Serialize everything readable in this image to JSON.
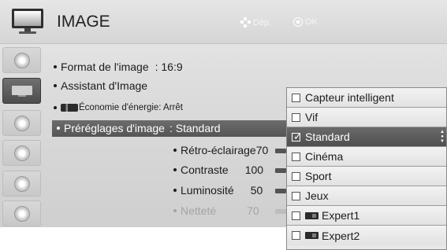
{
  "header": {
    "title": "IMAGE",
    "hint_move": "Dép.",
    "hint_ok": "OK"
  },
  "sidebar": {
    "items": [
      {
        "icon": "picture-tv-icon",
        "active": false
      },
      {
        "icon": "tv-screen-icon",
        "active": true
      },
      {
        "icon": "speaker-icon",
        "active": false
      },
      {
        "icon": "clock-icon",
        "active": false
      },
      {
        "icon": "lock-icon",
        "active": false
      },
      {
        "icon": "option-icon",
        "active": false
      }
    ]
  },
  "menu": {
    "format_label": "Format de l'image",
    "format_value": ": 16:9",
    "assistant_label": "Assistant d'Image",
    "eco_label": "Économie d'énergie: Arrêt",
    "preset_label": "Préréglages d'image",
    "preset_value": ": Standard"
  },
  "settings": [
    {
      "label": "Rétro-éclairage",
      "value": "70",
      "dim": false
    },
    {
      "label": "Contraste",
      "value": "100",
      "dim": false
    },
    {
      "label": "Luminosité",
      "value": "50",
      "dim": false
    },
    {
      "label": "Netteté",
      "value": "70",
      "dim": true
    }
  ],
  "dropdown": {
    "options": [
      {
        "label": "Capteur intelligent",
        "checked": false,
        "expert": false
      },
      {
        "label": "Vif",
        "checked": false,
        "expert": false
      },
      {
        "label": "Standard",
        "checked": true,
        "expert": false
      },
      {
        "label": "Cinéma",
        "checked": false,
        "expert": false
      },
      {
        "label": "Sport",
        "checked": false,
        "expert": false
      },
      {
        "label": "Jeux",
        "checked": false,
        "expert": false
      },
      {
        "label": "Expert1",
        "checked": false,
        "expert": true
      },
      {
        "label": "Expert2",
        "checked": false,
        "expert": true
      }
    ],
    "selected_index": 2
  },
  "colors": {
    "panel_bg": "#d9d9d9",
    "highlight": "#5e5e5e",
    "text": "#1c1c1c"
  }
}
